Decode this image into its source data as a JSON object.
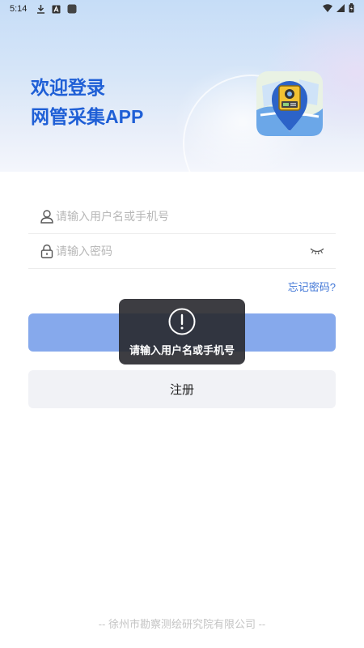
{
  "status_bar": {
    "time": "5:14",
    "icons": [
      "download-icon",
      "a-icon",
      "app-square-icon",
      "wifi-icon",
      "signal-icon",
      "battery-icon"
    ]
  },
  "welcome": {
    "line1": "欢迎登录",
    "line2": "网管采集APP"
  },
  "login_form": {
    "username_placeholder": "请输入用户名或手机号",
    "password_placeholder": "请输入密码",
    "forgot_password": "忘记密码?"
  },
  "buttons": {
    "login_label": "",
    "register_label": "注册"
  },
  "toast": {
    "message": "请输入用户名或手机号"
  },
  "footer": {
    "company": "-- 徐州市勘察测绘研究院有限公司 --"
  },
  "colors": {
    "title_blue": "#1f5fd6",
    "login_button": "#86a9ec",
    "link_blue": "#3e74d6",
    "register_button": "#f1f2f6"
  }
}
